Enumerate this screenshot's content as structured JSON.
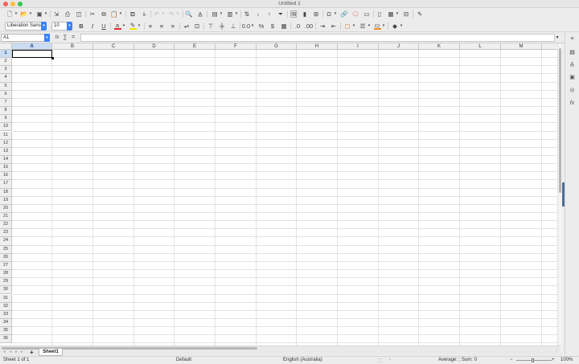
{
  "window": {
    "title": "Untitled 1"
  },
  "toolbar1": {
    "icons": [
      "new-document",
      "open",
      "save",
      "export",
      "export-pdf",
      "print",
      "print-preview",
      "cut",
      "copy",
      "paste",
      "clone-formatting",
      "clear-formatting",
      "undo",
      "redo",
      "find-replace",
      "spelling",
      "row",
      "column",
      "sort",
      "sort-ascending",
      "sort-descending",
      "autofilter",
      "image",
      "chart",
      "pivot-table",
      "special-character",
      "hyperlink",
      "comment",
      "headers-footers",
      "define-print-area",
      "freeze-rows-columns",
      "split-window",
      "show-draw-functions"
    ]
  },
  "toolbar2": {
    "font_name": "Liberation Sans",
    "font_size": "10",
    "font_color": "#e8282b",
    "highlight_color": "#f5e600",
    "border_color": "#f08a24",
    "icons": [
      "bold",
      "italic",
      "underline",
      "font-color",
      "highlighting",
      "align-left",
      "align-center",
      "align-right",
      "wrap-text",
      "merge-center",
      "align-top",
      "center-vertically",
      "align-bottom",
      "number-format",
      "percent",
      "currency",
      "date",
      "add-decimal",
      "delete-decimal",
      "increase-indent",
      "decrease-indent",
      "borders",
      "border-style",
      "border-color",
      "conditional"
    ]
  },
  "formula": {
    "cell_ref": "A1",
    "fx": "fx",
    "sum": "∑",
    "equals": "=",
    "content": ""
  },
  "grid": {
    "columns": [
      "A",
      "B",
      "C",
      "D",
      "E",
      "F",
      "G",
      "H",
      "I",
      "J",
      "K",
      "L",
      "M"
    ],
    "rows": [
      "1",
      "2",
      "3",
      "4",
      "5",
      "6",
      "7",
      "8",
      "9",
      "10",
      "11",
      "12",
      "13",
      "14",
      "15",
      "16",
      "17",
      "18",
      "19",
      "20",
      "21",
      "22",
      "23",
      "24",
      "25",
      "26",
      "27",
      "28",
      "29",
      "30",
      "31",
      "32",
      "33",
      "34",
      "35",
      "36"
    ],
    "selected_cell": "A1"
  },
  "sheets": {
    "tabs": [
      "Sheet1"
    ],
    "active": "Sheet1",
    "add_label": "+"
  },
  "status": {
    "sheet": "Sheet 1 of 1",
    "page_style": "Default",
    "language": "English (Australia)",
    "summary": "Average: ; Sum: 0",
    "zoom": "100%",
    "zoom_minus": "−",
    "zoom_plus": "+"
  },
  "sidebar": {
    "icons": [
      "properties",
      "styles",
      "gallery",
      "navigator",
      "functions"
    ]
  }
}
